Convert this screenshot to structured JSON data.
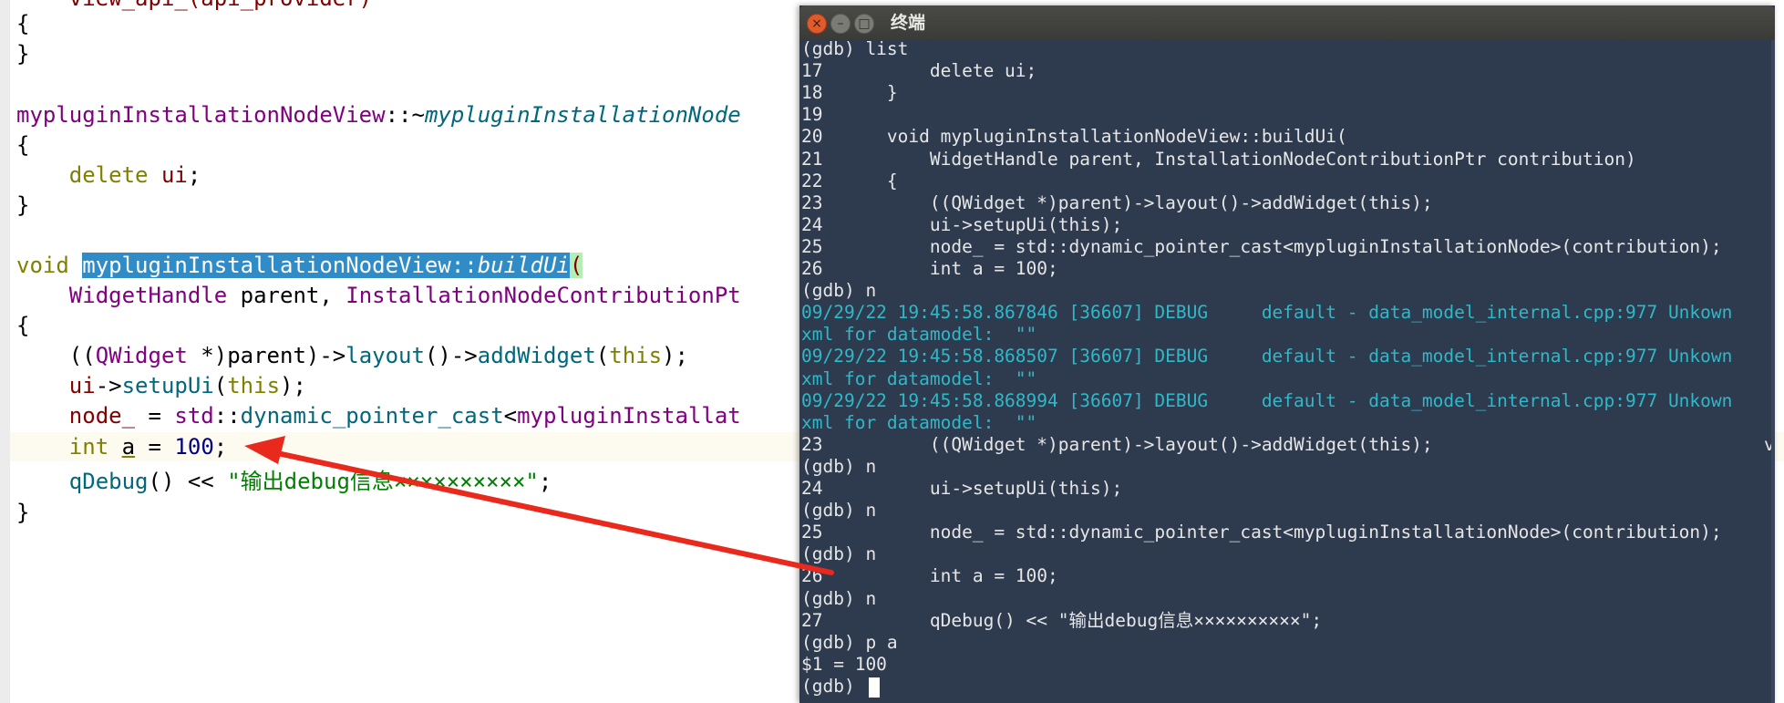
{
  "editor": {
    "lines": {
      "l1": [
        "    view_api_(api_provider)"
      ],
      "brace": "{",
      "close": "}",
      "dtor_class": "mypluginInstallationNodeView",
      "dtor_sep": "::~",
      "dtor_name": "mypluginInstallationNode",
      "delete_kw": "delete",
      "delete_var": "ui",
      "semi": ";",
      "void_kw": "void",
      "buildui_class": "mypluginInstallationNodeView::",
      "buildui_name": "buildUi",
      "paren": "(",
      "param_type1": "WidgetHandle",
      "param_name1": "parent,",
      "param_type2": "InstallationNodeContributionPt",
      "addwidget_line": {
        "a": "((",
        "b": "QWidget",
        "c": " *)parent)->",
        "d": "layout",
        "e": "()->",
        "f": "addWidget",
        "g": "(",
        "h": "this",
        "i": ");"
      },
      "setup_line": {
        "a": "ui",
        "b": "->",
        "c": "setupUi",
        "d": "(",
        "e": "this",
        "f": ");"
      },
      "node_line": {
        "a": "node_",
        "b": " = ",
        "c": "std",
        "d": "::",
        "e": "dynamic_pointer_cast",
        "f": "<",
        "g": "mypluginInstallat"
      },
      "int_line": {
        "a": "int",
        "b": " ",
        "c": "a",
        "d": " = ",
        "e": "100",
        "f": ";"
      },
      "qdebug_line": {
        "a": "qDebug",
        "b": "() << ",
        "c": "\"输出debug信息××××××××××\"",
        "d": ";"
      },
      "top_line": "    view_api_(api_provider)"
    }
  },
  "terminal": {
    "title": "终端",
    "lines": [
      "(gdb) list",
      "17          delete ui;",
      "18      }",
      "19",
      "20      void mypluginInstallationNodeView::buildUi(",
      "21          WidgetHandle parent, InstallationNodeContributionPtr contribution)",
      "22      {",
      "23          ((QWidget *)parent)->layout()->addWidget(this);",
      "24          ui->setupUi(this);",
      "25          node_ = std::dynamic_pointer_cast<mypluginInstallationNode>(contribution);",
      "26          int a = 100;",
      "(gdb) n",
      "09/29/22 19:45:58.867846 [36607] DEBUG     default - data_model_internal.cpp:977 Unkown",
      "xml for datamodel:  \"\"",
      "09/29/22 19:45:58.868507 [36607] DEBUG     default - data_model_internal.cpp:977 Unkown",
      "xml for datamodel:  \"\"",
      "09/29/22 19:45:58.868994 [36607] DEBUG     default - data_model_internal.cpp:977 Unkown",
      "xml for datamodel:  \"\"",
      "23          ((QWidget *)parent)->layout()->addWidget(this);",
      "(gdb) n",
      "24          ui->setupUi(this);",
      "(gdb) n",
      "25          node_ = std::dynamic_pointer_cast<mypluginInstallationNode>(contribution);",
      "(gdb) n",
      "26          int a = 100;",
      "(gdb) n",
      "27          qDebug() << \"输出debug信息××××××××××\";",
      "(gdb) p a",
      "$1 = 100",
      "(gdb) "
    ],
    "edge_char": "v"
  },
  "colors": {
    "terminal_bg": "#2e3b4f",
    "debug_text": "#2fb8c8",
    "selection": "#308cc6",
    "arrow": "#e8291c"
  }
}
